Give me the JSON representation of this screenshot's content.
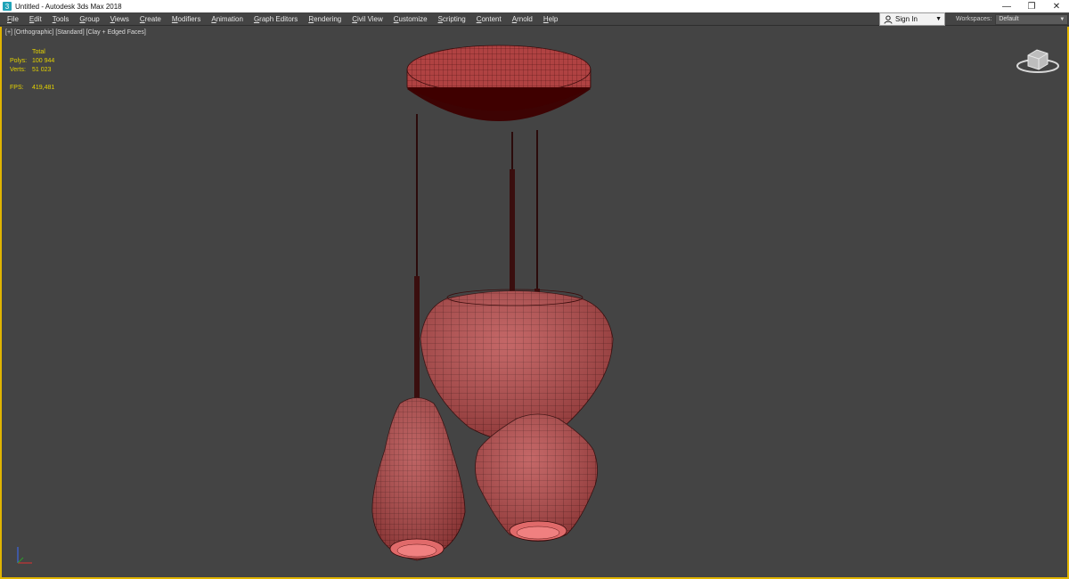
{
  "window": {
    "title": "Untitled - Autodesk 3ds Max 2018",
    "icon": "3ds-max-app-icon",
    "controls": {
      "minimize": "—",
      "restore": "❐",
      "close": "✕"
    }
  },
  "menu": {
    "items": [
      "File",
      "Edit",
      "Tools",
      "Group",
      "Views",
      "Create",
      "Modifiers",
      "Animation",
      "Graph Editors",
      "Rendering",
      "Civil View",
      "Customize",
      "Scripting",
      "Content",
      "Arnold",
      "Help"
    ]
  },
  "signin": {
    "label": "Sign In",
    "icon": "user-icon"
  },
  "workspaces": {
    "label": "Workspaces:",
    "value": "Default"
  },
  "viewport": {
    "labels": [
      "[+]",
      "[Orthographic]",
      "[Standard]",
      "[Clay + Edged Faces]"
    ],
    "stats": {
      "header": "Total",
      "polys_label": "Polys:",
      "polys_value": "100 944",
      "verts_label": "Verts:",
      "verts_value": "51 023",
      "fps_label": "FPS:",
      "fps_value": "419,481"
    }
  },
  "colors": {
    "viewport_bg": "#444444",
    "active_border": "#e0b400",
    "stats_text": "#e4d200",
    "model_fill": "#b94848",
    "model_wire": "#3a0c0c"
  }
}
